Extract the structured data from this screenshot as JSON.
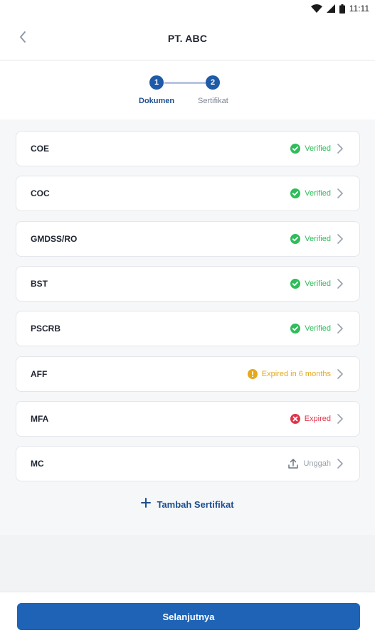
{
  "status_bar": {
    "time": "11:11"
  },
  "header": {
    "title": "PT. ABC",
    "back_icon": "chevron-left-icon"
  },
  "stepper": {
    "steps": [
      {
        "number": "1",
        "label": "Dokumen",
        "active": true
      },
      {
        "number": "2",
        "label": "Sertifikat",
        "active": false
      }
    ]
  },
  "documents": [
    {
      "name": "COE",
      "status": "Verified",
      "state": "verified"
    },
    {
      "name": "COC",
      "status": "Verified",
      "state": "verified"
    },
    {
      "name": "GMDSS/RO",
      "status": "Verified",
      "state": "verified"
    },
    {
      "name": "BST",
      "status": "Verified",
      "state": "verified"
    },
    {
      "name": "PSCRB",
      "status": "Verified",
      "state": "verified"
    },
    {
      "name": "AFF",
      "status": "Expired in 6 months",
      "state": "warning"
    },
    {
      "name": "MFA",
      "status": "Expired",
      "state": "expired"
    },
    {
      "name": "MC",
      "status": "Unggah",
      "state": "upload"
    }
  ],
  "add_certificate": {
    "label": "Tambah Sertifikat"
  },
  "footer": {
    "next_label": "Selanjutnya"
  },
  "colors": {
    "primary": "#1e63b6",
    "verified": "#2ebd5a",
    "warning": "#e5a91b",
    "expired": "#e0344a",
    "upload": "#9aa0a8"
  }
}
